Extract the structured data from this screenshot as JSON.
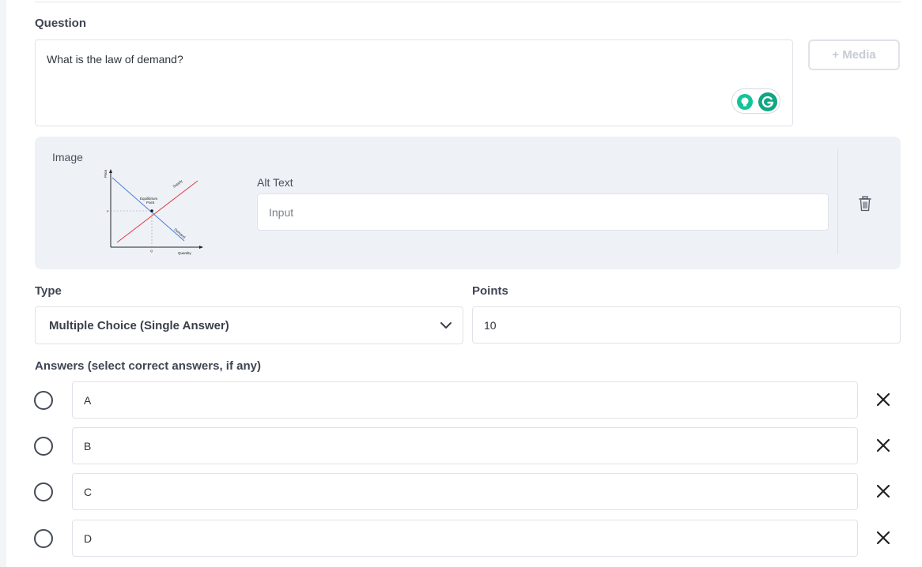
{
  "question": {
    "label": "Question",
    "text": "What is the law of demand?",
    "media_button": "+ Media"
  },
  "image_panel": {
    "label": "Image",
    "alt_text_label": "Alt Text",
    "alt_text_placeholder": "Input",
    "thumbnail": {
      "y_axis": "Price",
      "x_axis": "Quantity",
      "supply_label": "Supply",
      "demand_label": "Demand",
      "equilibrium_label_1": "Equilibrium",
      "equilibrium_label_2": "Point",
      "price_mark": "P",
      "quantity_mark": "Q"
    },
    "delete_icon": "trash-icon"
  },
  "type": {
    "label": "Type",
    "value": "Multiple Choice (Single Answer)"
  },
  "points": {
    "label": "Points",
    "value": "10"
  },
  "answers": {
    "label": "Answers (select correct answers, if any)",
    "items": [
      {
        "text": "A"
      },
      {
        "text": "B"
      },
      {
        "text": "C"
      },
      {
        "text": "D"
      }
    ]
  },
  "colors": {
    "supply_line": "#e23b3b",
    "demand_line": "#4a7fd6",
    "grammarly": "#15c39a"
  }
}
